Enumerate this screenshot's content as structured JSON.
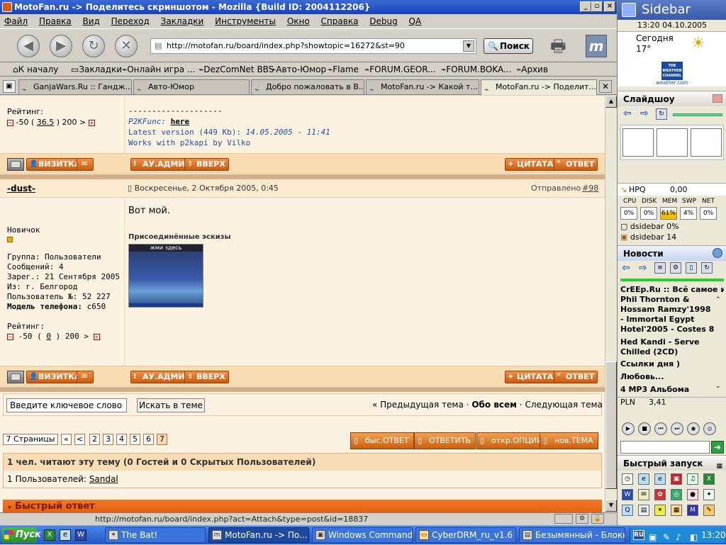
{
  "window": {
    "title": "MotoFan.ru -> Поделитесь скриншотом - Mozilla {Build ID: 2004112206}"
  },
  "menu": [
    "Файл",
    "Правка",
    "Вид",
    "Переход",
    "Закладки",
    "Инструменты",
    "Окно",
    "Справка",
    "Debug",
    "QA"
  ],
  "nav": {
    "url": "http://motofan.ru/board/index.php?showtopic=16272&st=90",
    "search_label": "Поиск"
  },
  "bookmarks": [
    "К началу",
    "Закладки",
    "Онлайн игра ...",
    "DezComNet BBS",
    "Авто-Юмор",
    "Flame",
    "FORUM.GEOR...",
    "FORUM.BOKA...",
    "Архив"
  ],
  "tabs": [
    "GanjaWars.Ru :: Гандж...",
    "Авто-Юмор",
    "Добро пожаловать в В...",
    "MotoFan.ru -> Какой т...",
    "MotoFan.ru -> Поделит..."
  ],
  "post1": {
    "rating_label": "Рейтинг:",
    "rating_pre": "-50 (",
    "rating_val": "36.5",
    "rating_post": ") 200 >",
    "dash": "--------------------",
    "p2k_label": "P2KFunc:",
    "p2k_link": "here",
    "latest": "Latest version (449 Kb):",
    "latest_date": "14.05.2005 - 11:41",
    "works": "Works with p2kapi by Vilko"
  },
  "actions": {
    "card": "ВИЗИТКА",
    "admin": "АУ.АДМИН",
    "up": "ВВЕРХ",
    "quote": "ЦИТАТА",
    "reply": "ОТВЕТ"
  },
  "post2": {
    "author": "-dust-",
    "date": "Воскресенье, 2 Октября 2005, 0:45",
    "sent_label": "Отправлено",
    "post_no": "#98",
    "rank": "Новичок",
    "group": "Группа: Пользователи",
    "messages": "Сообщений: 4",
    "registered": "Зарег.: 21 Сентября 2005",
    "from": "Из: г. Белгород",
    "user_no": "Пользователь №: 52 227",
    "phone_label": "Модель телефона:",
    "phone": "c650",
    "rating_label": "Рейтинг:",
    "rating_pre": "-50 (",
    "rating_val": "0",
    "rating_post": ") 200 >",
    "body": "Вот мой.",
    "attach_title": "Присоединённые эскизы",
    "thumb_caption": "жми здесь"
  },
  "search": {
    "placeholder": "Введите ключевое слово",
    "button": "Искать в теме",
    "prev": "« Предыдущая тема",
    "mid": "Обо всем",
    "next": "Следующая тема »",
    "sep": "·"
  },
  "pages": {
    "label": "7 Страницы",
    "first": "«",
    "prev": "<",
    "items": [
      "2",
      "3",
      "4",
      "5",
      "6",
      "7"
    ]
  },
  "post_buttons": [
    "быс.ОТВЕТ",
    "ОТВЕТИТЬ",
    "откр.ОПЦИИ",
    "нов.ТЕМА"
  ],
  "readers": {
    "title": "1 чел. читают эту тему (0 Гостей и 0 Скрытых Пользователей)",
    "users_label": "1 Пользователей:",
    "user": "Sandal"
  },
  "quick_reply": "Быстрый ответ",
  "status_url": "http://motofan.ru/board/index.php?act=Attach&type=post&id=18837",
  "sidebar": {
    "title": "Sidebar",
    "datetime": "13:20 04.10.2005",
    "weather_today": "Сегодня",
    "weather_temp": "17°",
    "weather_brand": "THE WEATHER CHANNEL",
    "weather_url": "weather.com",
    "slideshow": "Слайдшоу",
    "hpq_label": "HPQ",
    "hpq_value": "0,00",
    "sys_labels": [
      "CPU",
      "DISK",
      "MEM",
      "SWP",
      "NET"
    ],
    "sys_values": [
      "0%",
      "0%",
      "61%",
      "4%",
      "0%"
    ],
    "proc1": "dsidebar 0%",
    "proc2": "dsidebar 14",
    "news_title": "Новости",
    "news": [
      "CrEEp.Ru :: Всё самое интересное",
      "Phil Thornton & Hossam Ramzy'1998 - Immortal Egypt",
      "Hotel'2005 - Costes 8",
      "Hed Kandi - Serve Chilled (2CD)",
      "Ссылки дня )",
      "Любовь...",
      "4 MP3 Альбома"
    ],
    "pln_label": "PLN",
    "pln_value": "3,41",
    "quick_launch": "Быстрый запуск"
  },
  "taskbar": {
    "start": "Пуск",
    "tasks": [
      "The Bat!",
      "MotoFan.ru -> По...",
      "Windows Commander...",
      "CyberDRM_ru_v1.6",
      "Безымянный - Блокнот"
    ],
    "lang": "RU",
    "clock": "13:20"
  },
  "colors": {
    "accent": "#e87a28",
    "forum_bg": "#fcf2e2",
    "header_bg": "#f8dcb4",
    "title_bar": "#2a56c6"
  }
}
